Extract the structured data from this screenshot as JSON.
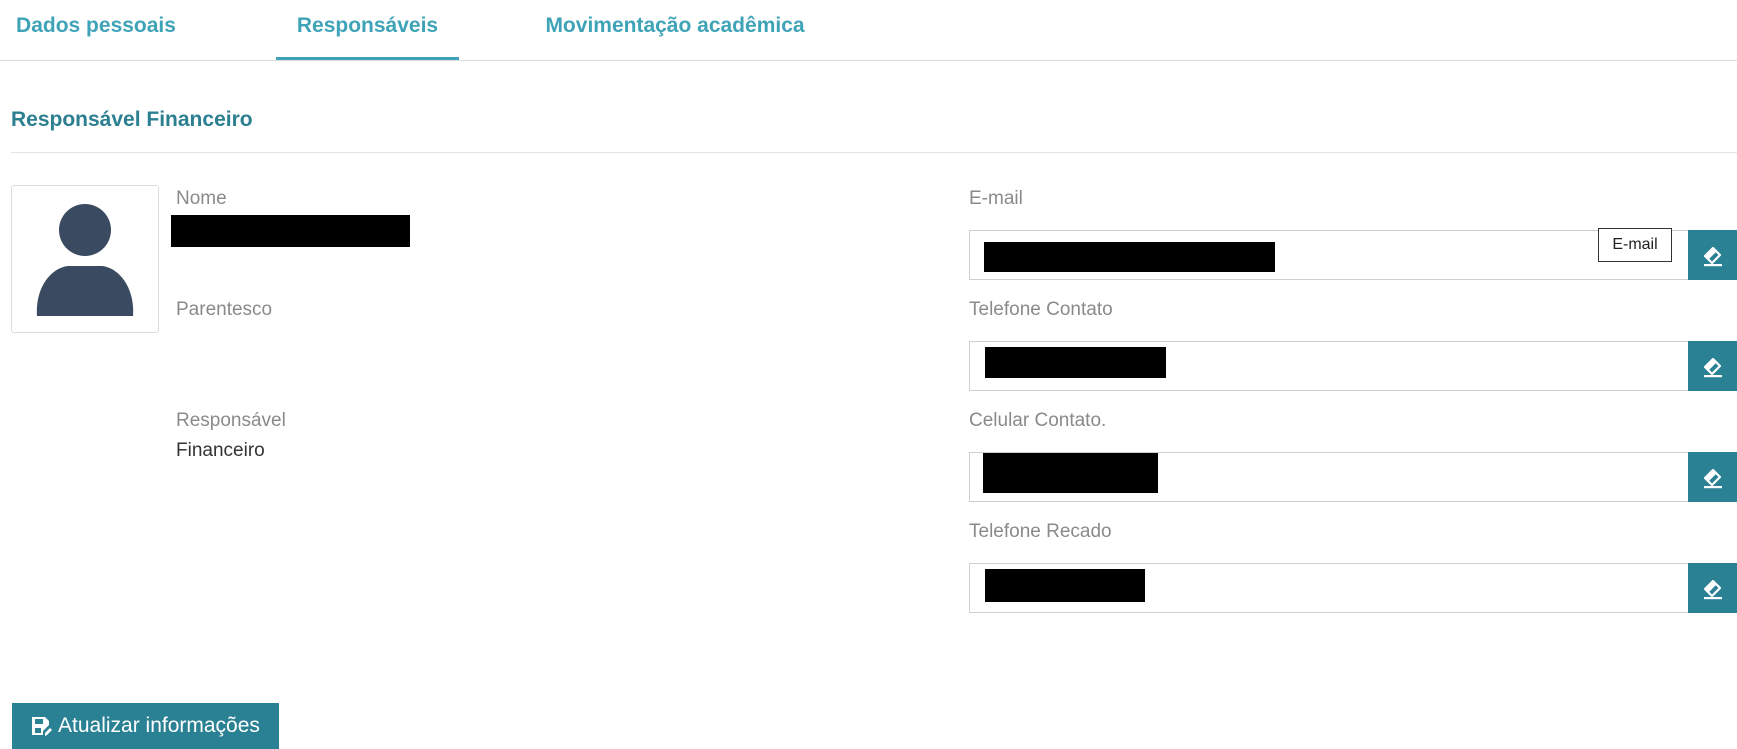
{
  "tabs": [
    {
      "label": "Dados pessoais",
      "active": false
    },
    {
      "label": "Responsáveis",
      "active": true
    },
    {
      "label": "Movimentação acadêmica",
      "active": false
    }
  ],
  "section": {
    "title": "Responsável Financeiro"
  },
  "person": {
    "name_label": "Nome",
    "relation_label": "Parentesco",
    "role_label": "Responsável",
    "role_value": "Financeiro",
    "avatar_icon": "user-silhouette-icon"
  },
  "contacts": [
    {
      "label": "E-mail",
      "button_icon": "eraser-icon"
    },
    {
      "label": "Telefone Contato",
      "button_icon": "eraser-icon"
    },
    {
      "label": "Celular Contato.",
      "button_icon": "eraser-icon"
    },
    {
      "label": "Telefone Recado",
      "button_icon": "eraser-icon"
    }
  ],
  "tooltip": {
    "text": "E-mail"
  },
  "actions": {
    "update_label": "Atualizar informações",
    "update_icon": "save-edit-icon"
  },
  "colors": {
    "accent": "#3fa3b8",
    "section_title": "#2c7f91",
    "button": "#2a8193",
    "avatar": "#3a4b61"
  }
}
